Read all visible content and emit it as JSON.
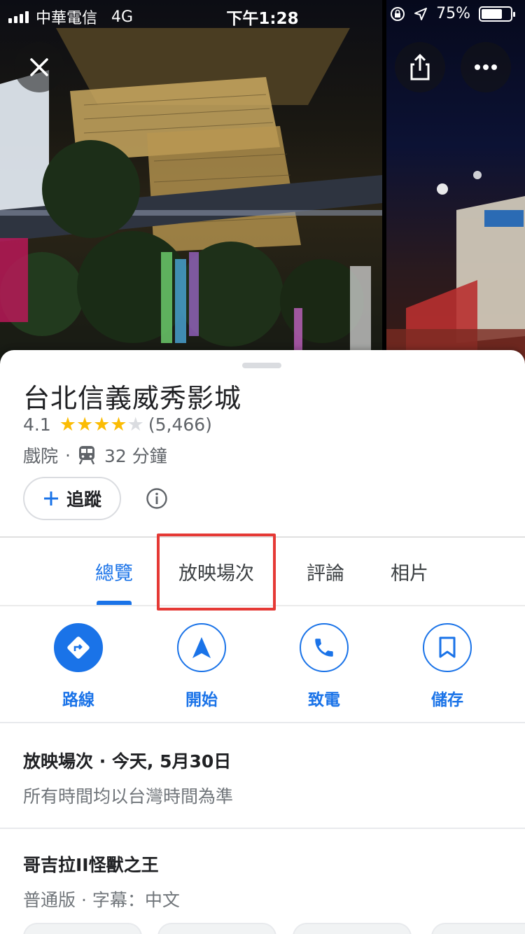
{
  "status_bar": {
    "carrier": "中華電信",
    "network": "4G",
    "time": "下午1:28",
    "battery": "75%",
    "battery_level": 0.75
  },
  "header_buttons": {
    "close_icon": "close-icon",
    "share_icon": "share-icon",
    "more_icon": "more-icon"
  },
  "place": {
    "name": "台北信義威秀影城",
    "rating": "4.1",
    "stars": 4,
    "reviews": "(5,466)",
    "category": "戲院",
    "separator": "·",
    "transit_time": "32 分鐘"
  },
  "follow_button": {
    "label": "追蹤"
  },
  "tabs": [
    {
      "label": "總覽",
      "active": true
    },
    {
      "label": "放映場次",
      "active": false
    },
    {
      "label": "評論",
      "active": false
    },
    {
      "label": "相片",
      "active": false
    }
  ],
  "actions": [
    {
      "label": "路線",
      "icon": "directions-icon"
    },
    {
      "label": "開始",
      "icon": "navigation-icon"
    },
    {
      "label": "致電",
      "icon": "phone-icon"
    },
    {
      "label": "儲存",
      "icon": "bookmark-icon"
    }
  ],
  "showtimes": {
    "title": "放映場次 · 今天, 5月30日",
    "note": "所有時間均以台灣時間為準"
  },
  "movie": {
    "title": "哥吉拉II怪獸之王",
    "format": "普通版 · 字幕：中文"
  },
  "colors": {
    "accent": "#1a73e8",
    "star": "#fbbc04",
    "highlight": "#e53935"
  }
}
